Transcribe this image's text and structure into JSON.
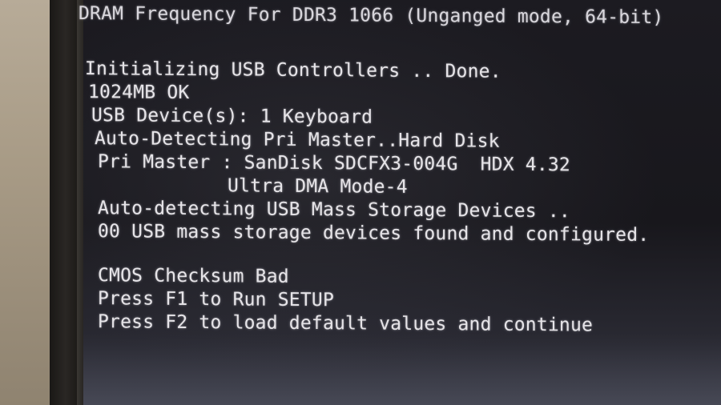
{
  "bios": {
    "header_line": "DRAM Frequency For DDR3 1066 (Unganged mode, 64-bit)",
    "usb_init": "Initializing USB Controllers .. Done.",
    "memory": "1024MB OK",
    "usb_devices": "USB Device(s): 1 Keyboard",
    "auto_detect_master": "Auto-Detecting Pri Master..Hard Disk",
    "pri_master": "Pri Master : SanDisk SDCFX3-004G  HDX 4.32",
    "pri_master_mode": "Ultra DMA Mode-4",
    "auto_detect_usb": "Auto-detecting USB Mass Storage Devices ..",
    "usb_mass_storage": "00 USB mass storage devices found and configured.",
    "cmos_error": "CMOS Checksum Bad",
    "prompt_setup": "Press F1 to Run SETUP",
    "prompt_defaults": "Press F2 to load default values and continue"
  }
}
